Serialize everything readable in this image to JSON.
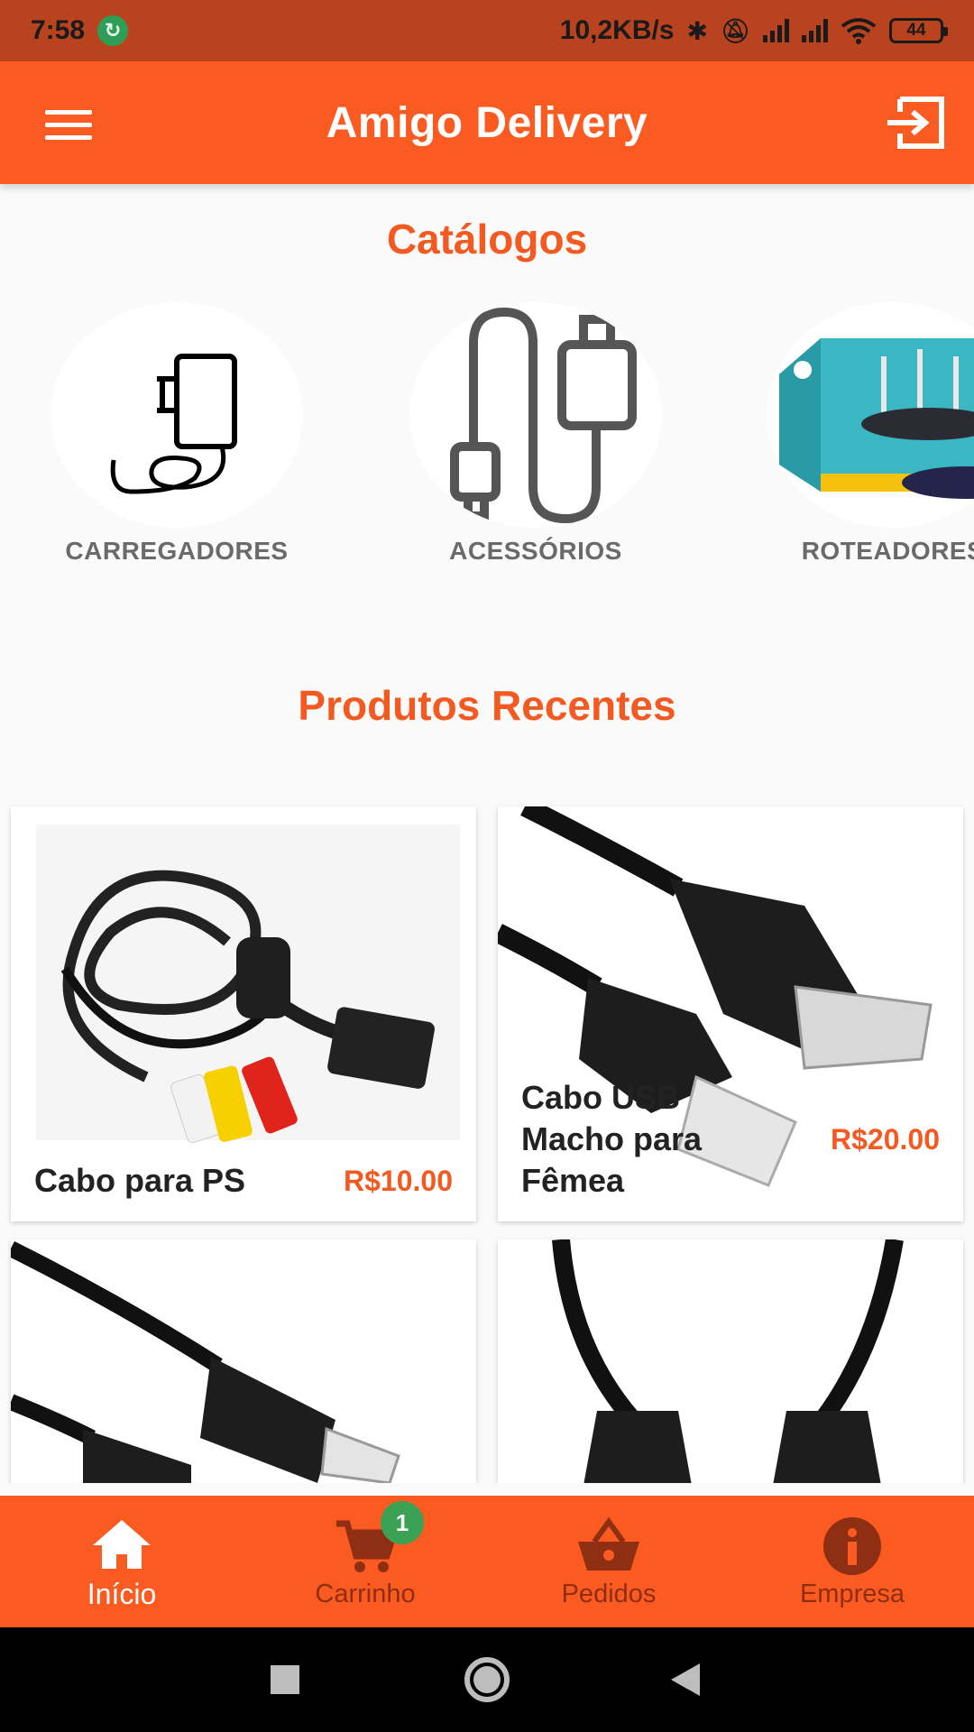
{
  "status_bar": {
    "time": "7:58",
    "net_speed": "10,2KB/s",
    "battery": "44"
  },
  "app_bar": {
    "title": "Amigo Delivery"
  },
  "catalogs": {
    "title": "Catálogos",
    "items": [
      {
        "label": "CARREGADORES",
        "icon": "charger-icon"
      },
      {
        "label": "ACESSÓRIOS",
        "icon": "cable-icon"
      },
      {
        "label": "ROTEADORES",
        "icon": "router-image"
      }
    ]
  },
  "recent": {
    "title": "Produtos Recentes",
    "products": [
      {
        "name": "Cabo para PS",
        "price": "R$10.00"
      },
      {
        "name": "Cabo USB Macho para Fêmea",
        "price": "R$20.00"
      },
      {
        "name": "",
        "price": ""
      },
      {
        "name": "",
        "price": ""
      }
    ]
  },
  "bottom_nav": {
    "items": [
      {
        "label": "Início",
        "icon": "home-icon",
        "active": true
      },
      {
        "label": "Carrinho",
        "icon": "cart-icon",
        "badge": "1"
      },
      {
        "label": "Pedidos",
        "icon": "basket-icon"
      },
      {
        "label": "Empresa",
        "icon": "info-icon"
      }
    ]
  },
  "colors": {
    "primary": "#fb5a21",
    "status_bar": "#b9431f",
    "accent_text": "#f25a22",
    "badge": "#3aa155"
  }
}
